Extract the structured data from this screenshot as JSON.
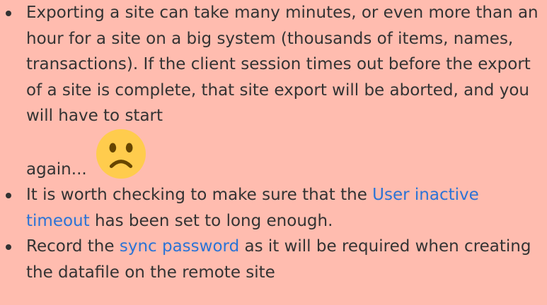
{
  "bullets": [
    {
      "text": "Exporting a site can take many minutes, or even more than an hour for a site on a big system (thousands of items, names, transactions). If the client session times out before the export of a site is complete, that site export will be aborted, and you will have to start",
      "trailing_text": "again...",
      "emoji": "sad-face-icon"
    },
    {
      "before": "It is worth checking to make sure that the ",
      "link": "User inactive timeout",
      "after": " has been set to long enough."
    },
    {
      "before": "Record the ",
      "link": "sync password",
      "after": " as it will be required when creating the datafile on the remote site"
    }
  ],
  "colors": {
    "background": "#ffbcaf",
    "text": "#333333",
    "link": "#2b73d6",
    "emoji_face": "#ffcc4d",
    "emoji_features": "#664500"
  }
}
